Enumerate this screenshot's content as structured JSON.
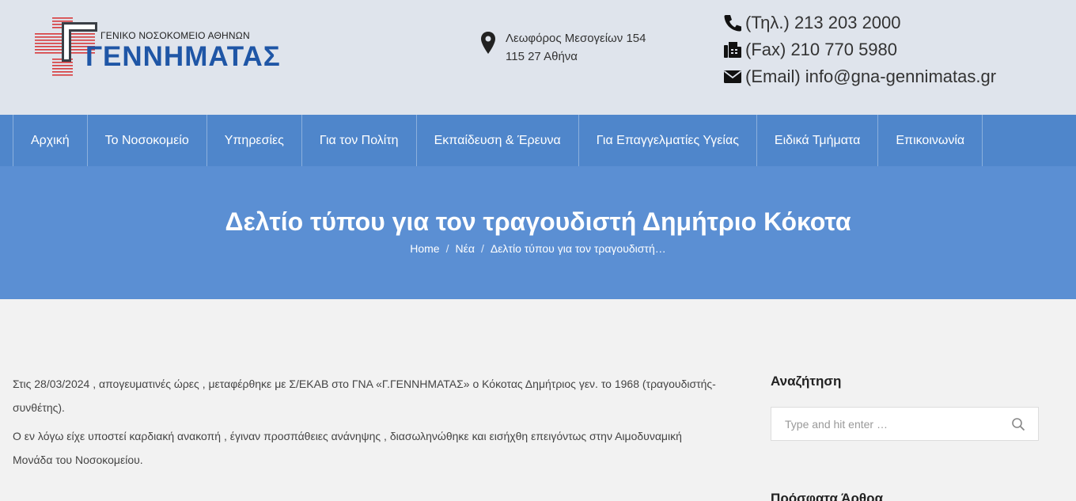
{
  "header": {
    "logo": {
      "subtitle": "ΓΕΝΙΚΟ ΝΟΣΟΚΟΜΕΙΟ ΑΘΗΝΩΝ",
      "name": "ΓΕΝΝΗΜΑΤΑΣ"
    },
    "address": {
      "line1": "Λεωφόρος Μεσογείων 154",
      "line2": "115 27 Αθήνα"
    },
    "contacts": {
      "phone": "(Τηλ.) 213 203 2000",
      "fax": "(Fax) 210 770 5980",
      "email": "(Email) info@gna-gennimatas.gr"
    }
  },
  "nav": {
    "items": [
      {
        "label": "Αρχική"
      },
      {
        "label": "Το Νοσοκομείο"
      },
      {
        "label": "Υπηρεσίες"
      },
      {
        "label": "Για τον Πολίτη"
      },
      {
        "label": "Εκπαίδευση & Έρευνα"
      },
      {
        "label": "Για Επαγγελματίες Υγείας"
      },
      {
        "label": "Ειδικά Τμήματα"
      },
      {
        "label": "Επικοινωνία"
      }
    ]
  },
  "page": {
    "title": "Δελτίο τύπου για τον τραγουδιστή Δημήτριο Κόκοτα",
    "breadcrumb": {
      "home": "Home",
      "section": "Νέα",
      "current": "Δελτίο τύπου για τον τραγουδιστή…"
    }
  },
  "article": {
    "p1": "Στις 28/03/2024 , απογευματινές ώρες , μεταφέρθηκε με Σ/ΕΚΑΒ στο ΓΝΑ «Γ.ΓΕΝΝΗΜΑΤΑΣ» ο Κόκοτας Δημήτριος γεν. το 1968 (τραγουδιστής- συνθέτης).",
    "p2": "Ο εν λόγω είχε υποστεί καρδιακή ανακοπή , έγιναν προσπάθειες ανάνηψης , διασωληνώθηκε και εισήχθη επειγόντως στην Αιμοδυναμική Μονάδα του Νοσοκομείου."
  },
  "sidebar": {
    "search_title": "Αναζήτηση",
    "search_placeholder": "Type and hit enter …",
    "recent_title": "Πρόσφατα Άρθρα"
  },
  "colors": {
    "nav_bg": "#4f86cb",
    "title_bg": "#5b8fd3",
    "header_bg": "#dfe4ec",
    "logo_blue": "#1f56a6",
    "logo_red": "#d8383a"
  },
  "icons": {
    "address": "map-pin-icon",
    "phone": "phone-icon",
    "fax": "fax-icon",
    "email": "envelope-icon",
    "search": "search-icon"
  }
}
